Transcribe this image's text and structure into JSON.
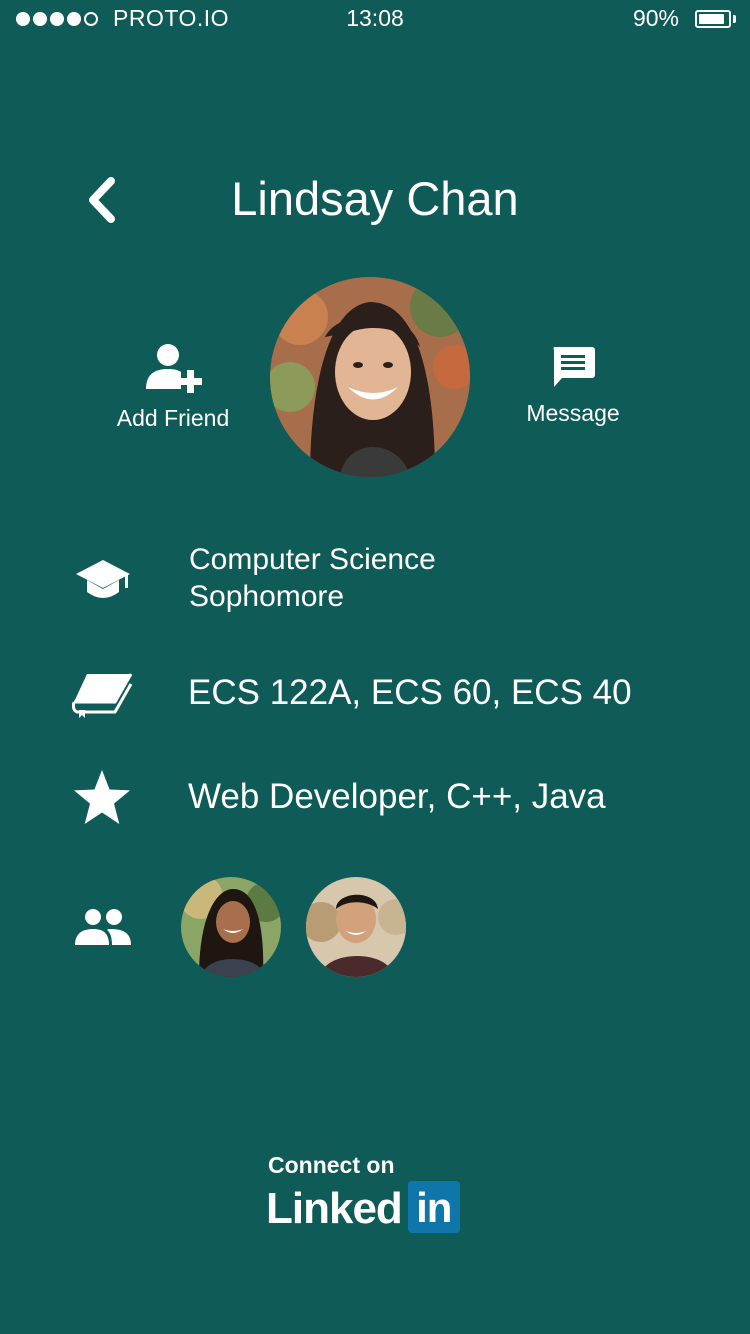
{
  "status_bar": {
    "carrier": "PROTO.IO",
    "time": "13:08",
    "battery_percent": "90%",
    "battery_level": 0.9,
    "signal_bars_filled": 4,
    "signal_bars_total": 5
  },
  "header": {
    "title": "Lindsay Chan",
    "back_icon": "chevron-left-icon"
  },
  "profile": {
    "add_friend_label": "Add Friend",
    "message_label": "Message"
  },
  "info": {
    "major": "Computer Science",
    "year": "Sophomore",
    "courses": "ECS 122A, ECS 60, ECS 40",
    "skills": "Web Developer, C++, Java"
  },
  "icons": {
    "education": "graduation-cap-icon",
    "courses": "book-icon",
    "skills": "star-icon",
    "friends": "group-icon"
  },
  "linkedin": {
    "connect_text": "Connect on",
    "brand_word": "Linked",
    "brand_box": "in"
  },
  "colors": {
    "background": "#0f5b58",
    "text": "#ffffff",
    "linkedin_blue": "#0e76a8"
  }
}
